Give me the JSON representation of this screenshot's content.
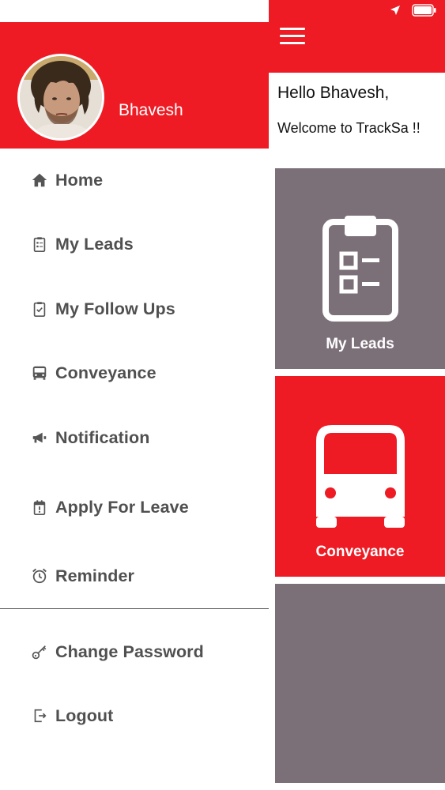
{
  "drawer": {
    "user_name": "Bhavesh",
    "items": [
      {
        "label": "Home",
        "icon": "home-icon"
      },
      {
        "label": "My Leads",
        "icon": "clipboard-list-icon"
      },
      {
        "label": "My Follow Ups",
        "icon": "clipboard-check-icon"
      },
      {
        "label": "Conveyance",
        "icon": "bus-icon"
      },
      {
        "label": "Notification",
        "icon": "megaphone-icon"
      },
      {
        "label": "Apply For Leave",
        "icon": "calendar-alert-icon"
      },
      {
        "label": "Reminder",
        "icon": "alarm-clock-icon"
      }
    ],
    "bottom_items": [
      {
        "label": "Change Password",
        "icon": "key-icon"
      },
      {
        "label": "Logout",
        "icon": "logout-icon"
      }
    ]
  },
  "main": {
    "greeting": "Hello Bhavesh,",
    "welcome": "Welcome to TrackSa !!",
    "tiles": [
      {
        "label": "My Leads",
        "icon": "clipboard-list-icon",
        "color": "#7b6f78"
      },
      {
        "label": "Conveyance",
        "icon": "bus-icon",
        "color": "#ee1b24"
      },
      {
        "label": "",
        "icon": "",
        "color": "#7b6f78"
      }
    ]
  },
  "status_bar": {
    "icons": [
      "location-arrow-icon",
      "battery-icon"
    ]
  },
  "colors": {
    "brand_red": "#ee1b24",
    "tile_gray": "#7b6f78",
    "menu_text": "#505050"
  }
}
